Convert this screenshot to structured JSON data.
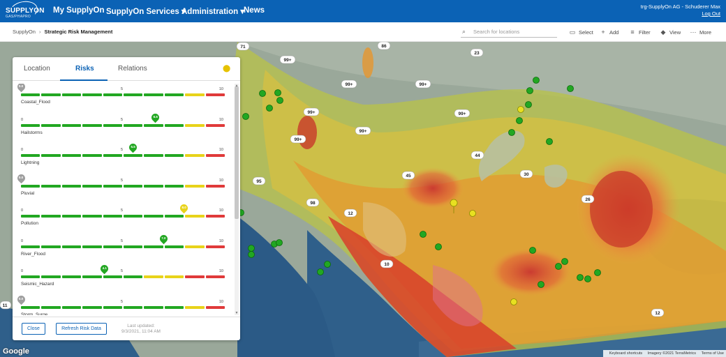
{
  "header": {
    "logo_text": "SUPPLYON",
    "logo_sub": "GAS/PHAPRO",
    "nav": [
      "My SupplyOn",
      "SupplyOn Services ▾",
      "Administration ▾",
      "News"
    ],
    "user": "trg-SupplyOn AG - Schuderer Max",
    "logout": "Log Out"
  },
  "subheader": {
    "breadcrumb_root": "SupplyOn",
    "breadcrumb_current": "Strategic Risk Management",
    "search_placeholder": "Search for locations",
    "tools": [
      "Select",
      "Add",
      "Filter",
      "View",
      "More"
    ]
  },
  "panel": {
    "tabs": [
      "Location",
      "Risks",
      "Relations"
    ],
    "active_tab": "Risks",
    "risks": [
      {
        "name": "Coastal_Flood",
        "value": "0.0",
        "level": 0.0,
        "color": "#9e9e9e"
      },
      {
        "name": "Hailstorms",
        "value": "6.6",
        "level": 6.6,
        "color": "#22a722"
      },
      {
        "name": "Lightning",
        "value": "5.5",
        "level": 5.5,
        "color": "#22a722"
      },
      {
        "name": "Pluvial",
        "value": "0.0",
        "level": 0.0,
        "color": "#9e9e9e"
      },
      {
        "name": "Pollution",
        "value": "8.0",
        "level": 8.0,
        "color": "#e8d31a"
      },
      {
        "name": "River_Flood",
        "value": "7.0",
        "level": 7.0,
        "color": "#22a722"
      },
      {
        "name": "Seismic_Hazard",
        "value": "4.1",
        "level": 4.1,
        "color": "#22a722"
      },
      {
        "name": "Storm_Surge",
        "value": "0.0",
        "level": 0.0,
        "color": "#9e9e9e"
      }
    ],
    "scale": {
      "min": "0",
      "mid": "5",
      "max": "10"
    },
    "close_label": "Close",
    "refresh_label": "Refresh Risk Data",
    "updated_label": "Last updated:",
    "updated_value": "9/3/2021, 11:04 AM"
  },
  "map": {
    "clusters": [
      "71",
      "86",
      "23",
      "99+",
      "99+",
      "99+",
      "99+",
      "99+",
      "99+",
      "99+",
      "44",
      "45",
      "30",
      "95",
      "98",
      "12",
      "26",
      "10",
      "12",
      "11"
    ],
    "google": "Google",
    "attribution": [
      "Keyboard shortcuts",
      "Imagery ©2021 TerraMetrics",
      "Terms of Use"
    ]
  },
  "colors": {
    "brand": "#0b62b5",
    "green": "#22a722",
    "yellow": "#e8d31a",
    "red": "#e03a3a",
    "grey": "#9e9e9e"
  }
}
